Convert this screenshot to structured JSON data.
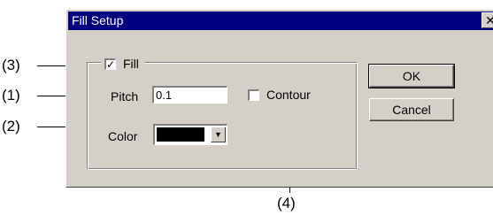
{
  "dialog": {
    "title": "Fill Setup",
    "close_glyph": "✕",
    "fill": {
      "label": "Fill",
      "checked": true,
      "check_glyph": "✓"
    },
    "pitch": {
      "label": "Pitch",
      "value": "0.1"
    },
    "contour": {
      "label": "Contour",
      "checked": false
    },
    "color": {
      "label": "Color",
      "value_color": "#000000",
      "arrow_glyph": "▼"
    },
    "ok_label": "OK",
    "cancel_label": "Cancel"
  },
  "callouts": {
    "c1": "(1)",
    "c2": "(2)",
    "c3": "(3)",
    "c4": "(4)"
  },
  "colors": {
    "face": "#d4d0c8",
    "titlebar": "#000080"
  }
}
